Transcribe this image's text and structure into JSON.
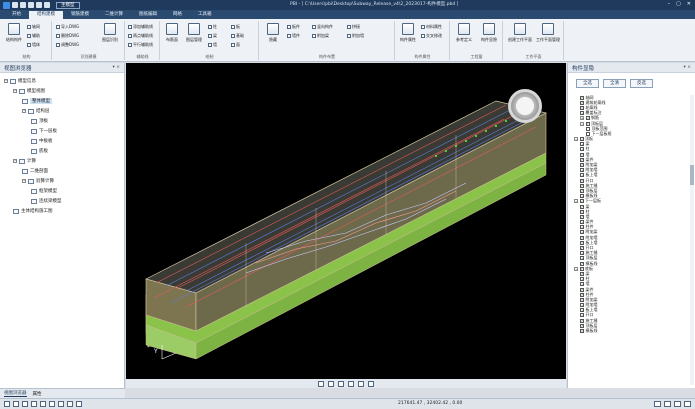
{
  "window": {
    "title": "PBI - [ C:\\Users\\pbi\\Desktop\\Subway_Release_v4\\2_2023017-构件模型.pbd ]",
    "quick_tab": "主模型",
    "controls": [
      "–",
      "▢",
      "✕"
    ]
  },
  "tabs": [
    "开始",
    "结构建模",
    "钢筋建模",
    "二维计算",
    "图纸编辑",
    "网格",
    "工具箱"
  ],
  "active_tab": 1,
  "ribbon": {
    "groups": [
      {
        "name": "结构",
        "big": [
          "结构构件"
        ],
        "small": [
          "轴网",
          "辅助",
          "墙体"
        ]
      },
      {
        "name": "识别建模",
        "small": [
          "导入DWG",
          "删除DWG",
          "调整DWG"
        ],
        "big": [
          "图层识别"
        ]
      },
      {
        "name": "辅助线",
        "small": [
          "添加辅助线",
          "两点辅助线",
          "平行辅助线"
        ]
      },
      {
        "name": "绘制",
        "big": [
          "布筋面",
          "图层管理"
        ],
        "small": [
          "柱",
          "梁",
          "墙",
          "板",
          "基础",
          "面"
        ]
      },
      {
        "name": "构件布置",
        "big": [
          "隐藏",
          "显示",
          "开挖面"
        ],
        "small": [
          "板件",
          "墙",
          "附加梁",
          "柱",
          "排梁",
          "板件"
        ]
      },
      {
        "name": "构件布置",
        "small": [
          "板件",
          "墙件",
          "竖向构件",
          "附加梁",
          "拼接",
          "附加墙"
        ]
      },
      {
        "name": "构件属性",
        "big": [
          "构件属性"
        ],
        "small": [
          "材料属性",
          "交叉修改"
        ]
      },
      {
        "name": "工程量",
        "big": [
          "参考定义",
          "构件显隐"
        ]
      },
      {
        "name": "工作平面",
        "big": [
          "创建工作平面",
          "工作平面管理"
        ]
      }
    ]
  },
  "left_panel": {
    "title": "视图浏览器",
    "nodes": [
      {
        "label": "模型信息",
        "level": 0,
        "exp": "−"
      },
      {
        "label": "模型视图",
        "level": 1,
        "exp": "−"
      },
      {
        "label": "整体模型",
        "level": 2,
        "selected": true
      },
      {
        "label": "结构层",
        "level": 2,
        "exp": "−"
      },
      {
        "label": "顶板",
        "level": 3
      },
      {
        "label": "下一层板",
        "level": 3
      },
      {
        "label": "中板板",
        "level": 3
      },
      {
        "label": "底板",
        "level": 3
      },
      {
        "label": "计算",
        "level": 1,
        "exp": "−"
      },
      {
        "label": "二维剖面",
        "level": 2
      },
      {
        "label": "验算计算",
        "level": 2,
        "exp": "−"
      },
      {
        "label": "框架模型",
        "level": 3
      },
      {
        "label": "连续梁模型",
        "level": 3
      },
      {
        "label": "主体结构施工图",
        "level": 1
      }
    ]
  },
  "bottom_tabs": [
    "视图浏览器",
    "属性"
  ],
  "right_panel": {
    "title": "构件显隐",
    "buttons": [
      "全选",
      "全清",
      "反选"
    ],
    "rows": [
      {
        "label": "轴网",
        "level": 1,
        "check": true
      },
      {
        "label": "建筑轮廓线",
        "level": 1,
        "check": true
      },
      {
        "label": "轮廓线",
        "level": 1,
        "check": true
      },
      {
        "label": "覆盖标注",
        "level": 1,
        "check": true
      },
      {
        "label": "钢筋",
        "level": 1,
        "check": true,
        "exp": "+"
      },
      {
        "label": "顶板层",
        "level": 1,
        "check": true,
        "exp": "−"
      },
      {
        "label": "顶板范围",
        "level": 2,
        "check": false
      },
      {
        "label": "下一层板框",
        "level": 2,
        "check": false
      },
      {
        "label": "顶板",
        "level": 0,
        "check": true,
        "exp": "−"
      },
      {
        "label": "梁",
        "level": 1,
        "check": true
      },
      {
        "label": "柱",
        "level": 1,
        "check": true
      },
      {
        "label": "墙",
        "level": 1,
        "check": true
      },
      {
        "label": "梁件",
        "level": 1,
        "check": true
      },
      {
        "label": "附加梁",
        "level": 1,
        "check": true
      },
      {
        "label": "附加墙",
        "level": 1,
        "check": true
      },
      {
        "label": "板上墙",
        "level": 1,
        "check": true
      },
      {
        "label": "开口",
        "level": 1,
        "check": true
      },
      {
        "label": "施工缝",
        "level": 1,
        "check": true
      },
      {
        "label": "顶板层",
        "level": 1,
        "check": true
      },
      {
        "label": "模板线",
        "level": 1,
        "check": true
      },
      {
        "label": "下一层板",
        "level": 0,
        "check": true,
        "exp": "−"
      },
      {
        "label": "梁",
        "level": 1,
        "check": true
      },
      {
        "label": "柱",
        "level": 1,
        "check": true
      },
      {
        "label": "墙",
        "level": 1,
        "check": true
      },
      {
        "label": "梁件",
        "level": 1,
        "check": true
      },
      {
        "label": "柱件",
        "level": 1,
        "check": true
      },
      {
        "label": "附加梁",
        "level": 1,
        "check": true
      },
      {
        "label": "附加墙",
        "level": 1,
        "check": true
      },
      {
        "label": "板上墙",
        "level": 1,
        "check": true
      },
      {
        "label": "开口",
        "level": 1,
        "check": true
      },
      {
        "label": "施工缝",
        "level": 1,
        "check": true
      },
      {
        "label": "顶板层",
        "level": 1,
        "check": true
      },
      {
        "label": "模板线",
        "level": 1,
        "check": true
      },
      {
        "label": "底板",
        "level": 0,
        "check": true,
        "exp": "−"
      },
      {
        "label": "梁",
        "level": 1,
        "check": true
      },
      {
        "label": "柱",
        "level": 1,
        "check": true
      },
      {
        "label": "墙",
        "level": 1,
        "check": true
      },
      {
        "label": "梁件",
        "level": 1,
        "check": true
      },
      {
        "label": "柱件",
        "level": 1,
        "check": true
      },
      {
        "label": "附加梁",
        "level": 1,
        "check": true
      },
      {
        "label": "附加墙",
        "level": 1,
        "check": true
      },
      {
        "label": "板上墙",
        "level": 1,
        "check": true
      },
      {
        "label": "开口",
        "level": 1,
        "check": true
      },
      {
        "label": "施工缝",
        "level": 1,
        "check": true
      },
      {
        "label": "顶板层",
        "level": 1,
        "check": true
      },
      {
        "label": "模板线",
        "level": 1,
        "check": true
      }
    ]
  },
  "status": {
    "coords": "217641.47 , 32402.42 , 0.00"
  },
  "colors": {
    "viewport_bg": "#000000",
    "slab_green": "#8bc34a",
    "wall_tan": "#c9b28a",
    "rebar_red": "#e05a5a",
    "rebar_blue": "#5a7de0"
  }
}
